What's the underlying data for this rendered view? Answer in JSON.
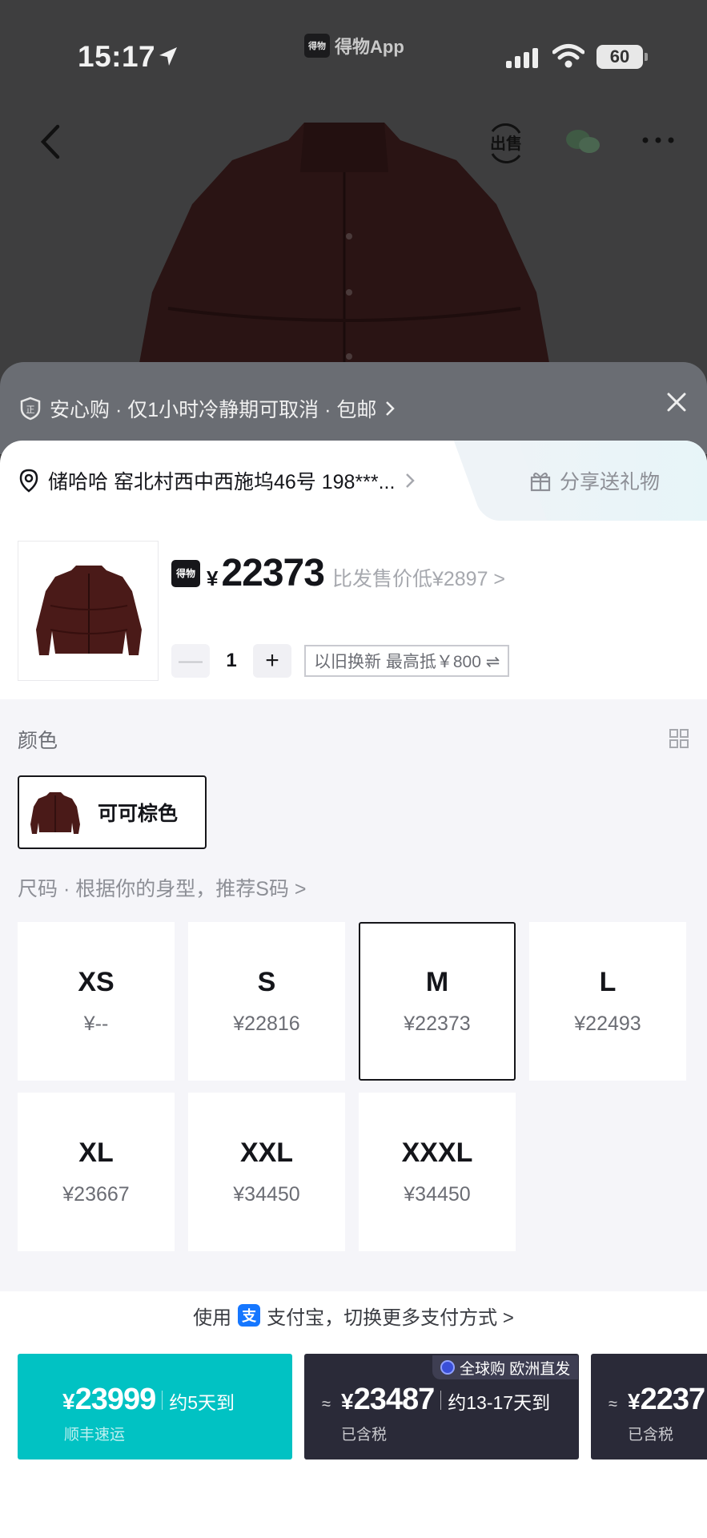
{
  "status_bar": {
    "time": "15:17",
    "app_name": "得物App",
    "app_logo_text": "得物",
    "battery": "60"
  },
  "nav": {
    "back_icon": "chevron-left-icon",
    "sell_label": "出售",
    "wechat_icon": "wechat-icon",
    "more_icon": "more-icon"
  },
  "promo": {
    "text": "安心购 · 仅1小时冷静期可取消 · 包邮",
    "shield_badge": "正"
  },
  "address": {
    "text": "储哈哈  窑北村西中西施坞46号 198***..."
  },
  "share": {
    "label": "分享送礼物"
  },
  "product": {
    "logo_text": "得物",
    "currency": "¥",
    "price": "22373",
    "lower_text": "比发售价低¥2897 >",
    "quantity": "1",
    "minus": "—",
    "plus": "+",
    "trade_in": "以旧换新  最高抵￥800 ⇌"
  },
  "color_section": {
    "title": "颜色",
    "options": [
      {
        "name": "可可棕色",
        "swatch": "#4a1a18"
      }
    ]
  },
  "size_section": {
    "title": "尺码 · 根据你的身型，推荐S码 >",
    "sizes": [
      {
        "size": "XS",
        "price": "¥--"
      },
      {
        "size": "S",
        "price": "¥22816"
      },
      {
        "size": "M",
        "price": "¥22373"
      },
      {
        "size": "L",
        "price": "¥22493"
      },
      {
        "size": "XL",
        "price": "¥23667"
      },
      {
        "size": "XXL",
        "price": "¥34450"
      },
      {
        "size": "XXXL",
        "price": "¥34450"
      }
    ],
    "selected": "M"
  },
  "payment": {
    "prefix": "使用",
    "alipay_icon": "支",
    "text": "支付宝，切换更多支付方式 >"
  },
  "buy_options": [
    {
      "currency": "¥",
      "price": "23999",
      "delivery": "约5天到",
      "sub": "顺丰速运",
      "color": "#01c2c3"
    },
    {
      "approx": "≈",
      "currency": "¥",
      "price": "23487",
      "delivery": "约13-17天到",
      "sub": "已含税",
      "tag": "全球购 欧洲直发",
      "color": "#2a2a38"
    },
    {
      "approx": "≈",
      "currency": "¥",
      "price": "2237",
      "sub": "已含税",
      "color": "#2a2a38"
    }
  ],
  "colors": {
    "accent_teal": "#01c2c3",
    "dark_button": "#2a2a38",
    "jacket": "#4a1a18"
  }
}
